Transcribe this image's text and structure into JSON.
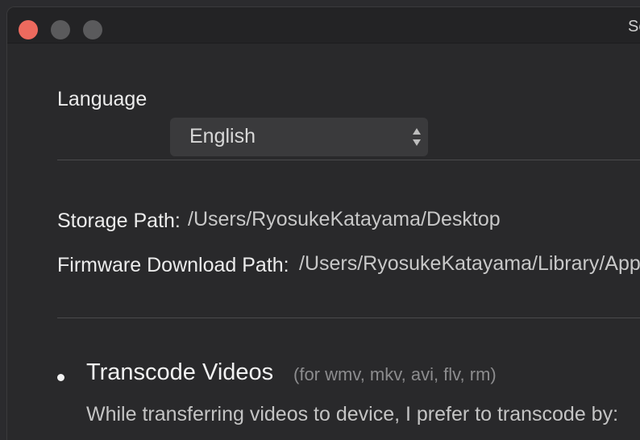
{
  "window": {
    "title": "Se"
  },
  "settings": {
    "language_label": "Language",
    "language_value": "English",
    "storage_path_label": "Storage Path:",
    "storage_path_value": "/Users/RyosukeKatayama/Desktop",
    "firmware_path_label": "Firmware Download Path:",
    "firmware_path_value": "/Users/RyosukeKatayama/Library/App"
  },
  "transcode": {
    "title": "Transcode Videos",
    "subtitle": "(for wmv, mkv, avi, flv, rm)",
    "description": "While transferring videos to device, I prefer to transcode by:"
  },
  "colors": {
    "close": "#ed6a5e",
    "inactive_button": "#5a5a5c",
    "background": "#29292b"
  }
}
